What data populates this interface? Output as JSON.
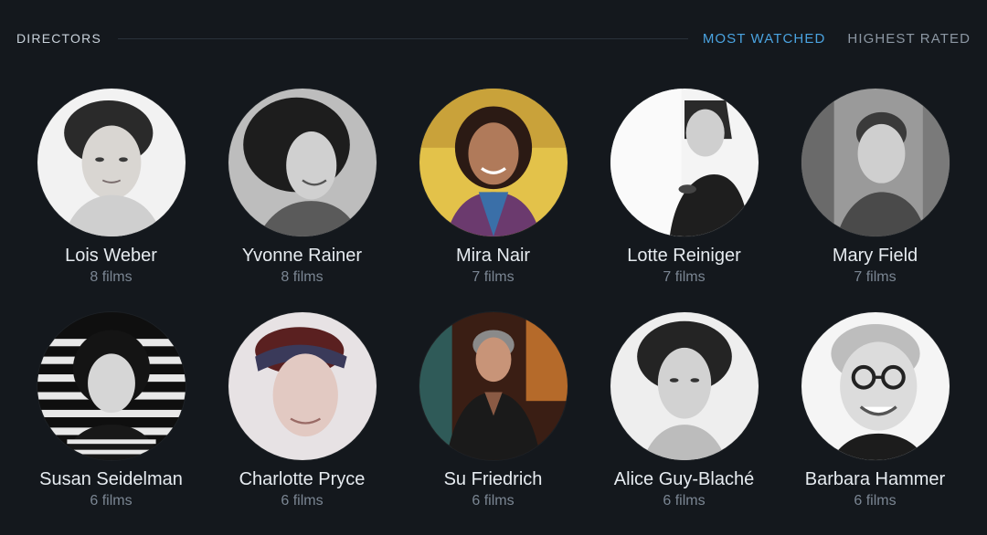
{
  "header": {
    "title": "DIRECTORS",
    "tabs": [
      {
        "label": "MOST WATCHED",
        "active": true
      },
      {
        "label": "HIGHEST RATED",
        "active": false
      }
    ]
  },
  "colors": {
    "accent": "#4aa3e0",
    "background": "#14181d"
  },
  "directors": [
    {
      "name": "Lois Weber",
      "count": "8 films",
      "icon": "portrait-photo"
    },
    {
      "name": "Yvonne Rainer",
      "count": "8 films",
      "icon": "portrait-photo"
    },
    {
      "name": "Mira Nair",
      "count": "7 films",
      "icon": "portrait-photo"
    },
    {
      "name": "Lotte Reiniger",
      "count": "7 films",
      "icon": "portrait-photo"
    },
    {
      "name": "Mary Field",
      "count": "7 films",
      "icon": "portrait-photo"
    },
    {
      "name": "Susan Seidelman",
      "count": "6 films",
      "icon": "portrait-photo"
    },
    {
      "name": "Charlotte Pryce",
      "count": "6 films",
      "icon": "portrait-photo"
    },
    {
      "name": "Su Friedrich",
      "count": "6 films",
      "icon": "portrait-photo"
    },
    {
      "name": "Alice Guy-Blaché",
      "count": "6 films",
      "icon": "portrait-photo"
    },
    {
      "name": "Barbara Hammer",
      "count": "6 films",
      "icon": "portrait-photo"
    }
  ]
}
